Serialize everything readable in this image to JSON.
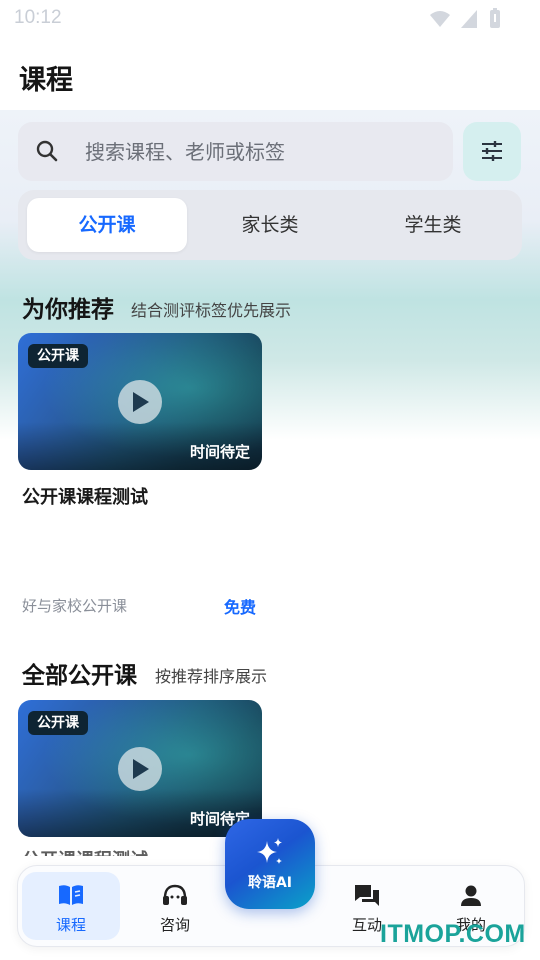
{
  "status_bar": {
    "time": "10:12"
  },
  "header": {
    "title": "课程"
  },
  "search": {
    "placeholder": "搜索课程、老师或标签"
  },
  "tabs": [
    {
      "label": "公开课",
      "active": true
    },
    {
      "label": "家长类",
      "active": false
    },
    {
      "label": "学生类",
      "active": false
    }
  ],
  "recommend": {
    "title": "为你推荐",
    "subtitle": "结合测评标签优先展示",
    "card": {
      "badge": "公开课",
      "time": "时间待定",
      "title": "公开课课程测试",
      "source": "好与家校公开课",
      "price": "免费"
    }
  },
  "all_courses": {
    "title": "全部公开课",
    "subtitle": "按推荐排序展示",
    "card": {
      "badge": "公开课",
      "time": "时间待定",
      "title": "公开课课程测试"
    }
  },
  "fab": {
    "label": "聆语AI"
  },
  "bottom_nav": [
    {
      "label": "课程",
      "icon": "book-icon",
      "active": true
    },
    {
      "label": "咨询",
      "icon": "headset-icon",
      "active": false
    },
    {
      "label": "互动",
      "icon": "chat-icon",
      "active": false
    },
    {
      "label": "我的",
      "icon": "person-icon",
      "active": false
    }
  ],
  "watermark": "ITMOP.COM",
  "colors": {
    "accent": "#1769ff",
    "teal": "#1aa39a",
    "fab_start": "#2f67e6",
    "fab_end": "#0aa2c8"
  }
}
